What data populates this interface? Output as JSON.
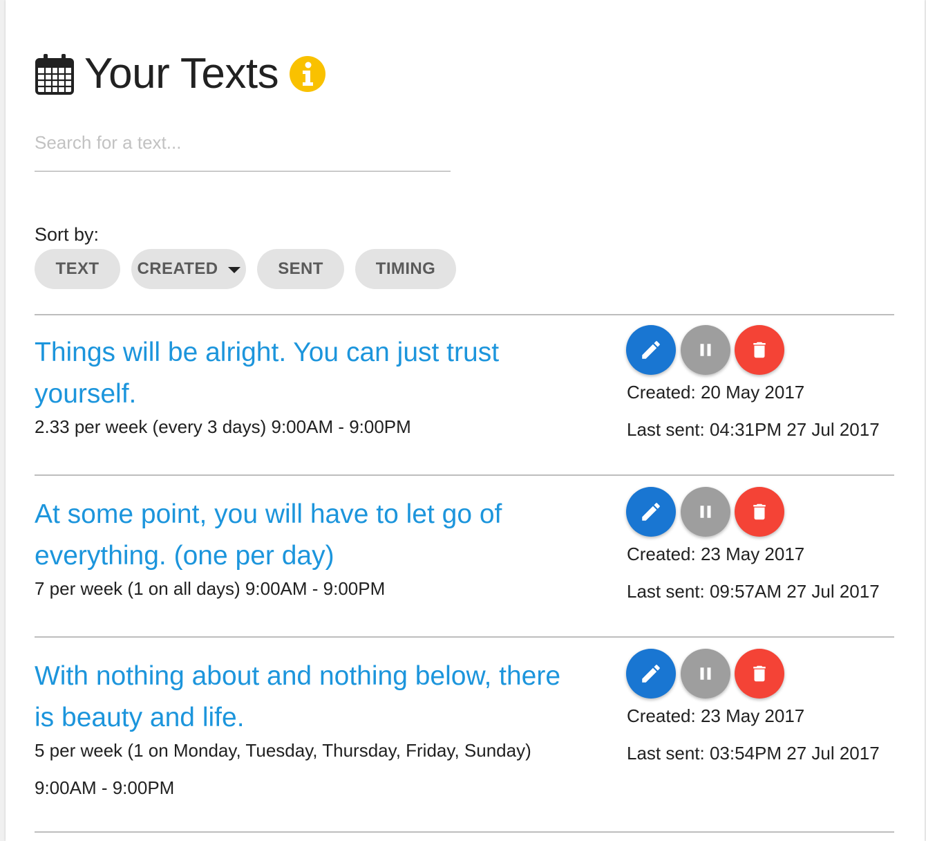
{
  "header": {
    "title": "Your Texts",
    "icon": "calendar-icon",
    "info_icon": "info-icon",
    "info_color": "#f9c100"
  },
  "search": {
    "placeholder": "Search for a text...",
    "value": ""
  },
  "sort": {
    "label": "Sort by:",
    "options": [
      {
        "label": "TEXT"
      },
      {
        "label": "CREATED"
      },
      {
        "label": "SENT"
      },
      {
        "label": "TIMING"
      }
    ],
    "active_option": "CREATED",
    "active_direction_icon": "caret-down-icon"
  },
  "colors": {
    "quote": "#1c95dc",
    "edit": "#1976d2",
    "pause": "#9e9e9e",
    "delete": "#f44336",
    "chip": "#e3e3e3"
  },
  "texts": [
    {
      "quote_line1": "Things will be alright. You can just trust",
      "quote_line2": "yourself.",
      "schedule_line1": "2.33 per week (every 3 days) 9:00AM - 9:00PM",
      "schedule_line2": "",
      "created": "Created: 20 May 2017",
      "last_sent": "Last sent: 04:31PM 27 Jul 2017"
    },
    {
      "quote_line1": "At some point, you will have to let go of",
      "quote_line2": "everything. (one per day)",
      "schedule_line1": "7 per week (1 on all days) 9:00AM - 9:00PM",
      "schedule_line2": "",
      "created": "Created: 23 May 2017",
      "last_sent": "Last sent: 09:57AM 27 Jul 2017"
    },
    {
      "quote_line1": "With nothing about and nothing below, there",
      "quote_line2": "is beauty and life.",
      "schedule_line1": "5 per week (1 on Monday, Tuesday, Thursday, Friday, Sunday)",
      "schedule_line2": "9:00AM - 9:00PM",
      "created": "Created: 23 May 2017",
      "last_sent": "Last sent: 03:54PM 27 Jul 2017"
    }
  ]
}
